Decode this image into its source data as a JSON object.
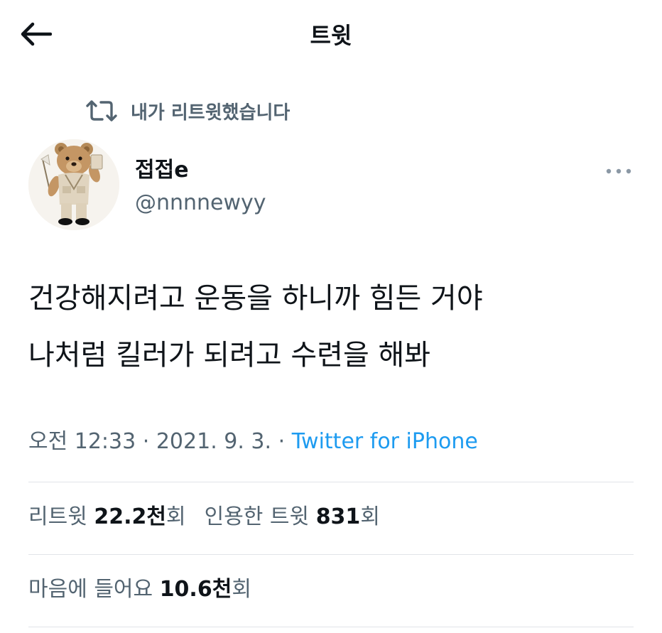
{
  "header": {
    "back_icon": "arrow-left-icon",
    "title": "트윗"
  },
  "retweet_context": {
    "icon": "retweet-icon",
    "label": "내가 리트윗했습니다"
  },
  "author": {
    "display_name": "접접e",
    "handle": "@nnnnewyy",
    "avatar": "teddy-bear-avatar"
  },
  "tweet": {
    "lines": [
      "건강해지려고 운동을 하니까 힘든 거야",
      "나처럼 킬러가 되려고 수련을 해봐"
    ],
    "time": "오전 12:33",
    "separator": "·",
    "date": "2021. 9. 3.",
    "source": "Twitter for iPhone"
  },
  "stats": {
    "retweets": {
      "label": "리트윗",
      "number": "22.2천",
      "suffix": "회"
    },
    "quotes": {
      "label": "인용한 트윗",
      "number": "831",
      "suffix": "회"
    },
    "likes": {
      "label": "마음에 들어요",
      "number": "10.6천",
      "suffix": "회"
    }
  },
  "colors": {
    "text": "#0f1419",
    "secondary": "#536471",
    "link": "#1d9bf0",
    "divider": "#e1e4e8"
  }
}
